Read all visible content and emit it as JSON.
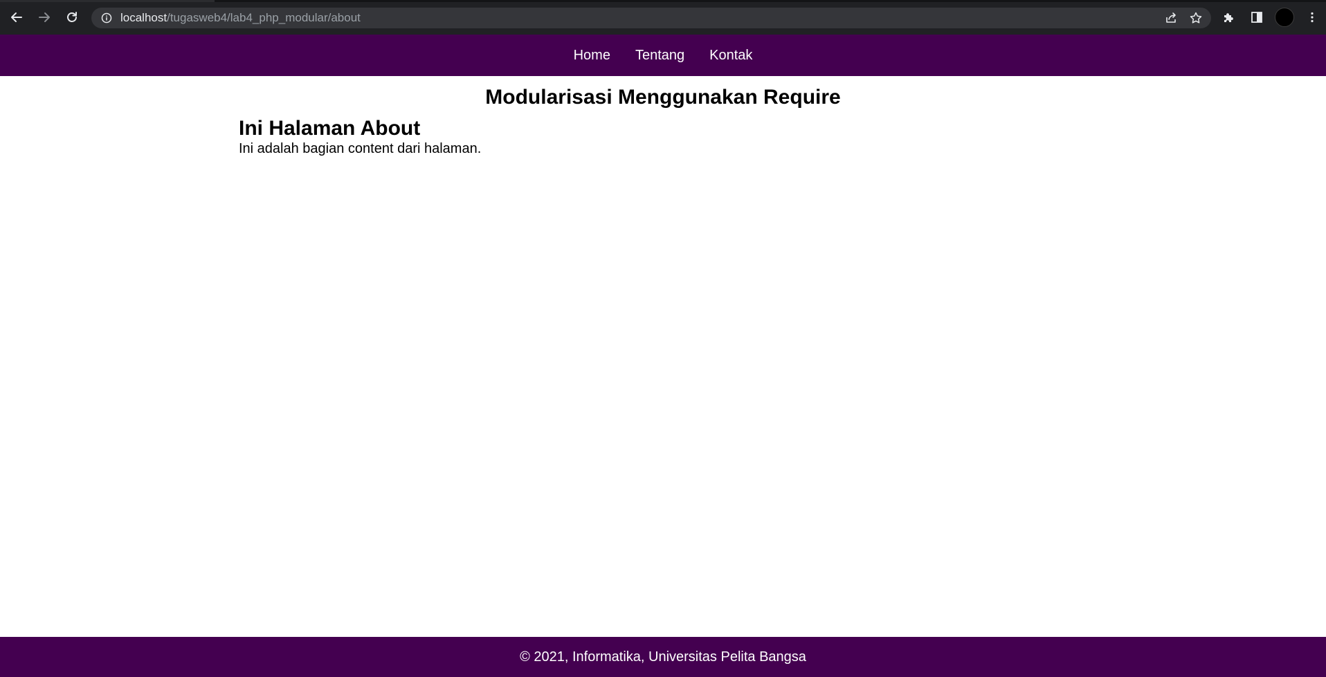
{
  "browser": {
    "url_host": "localhost",
    "url_path": "/tugasweb4/lab4_php_modular/about",
    "icons": {
      "back": "arrow-left-icon",
      "forward": "arrow-right-icon",
      "reload": "reload-icon",
      "info": "info-icon",
      "share": "share-icon",
      "bookmark": "star-icon",
      "extensions": "puzzle-icon",
      "side_panel": "side-panel-icon",
      "profile": "avatar",
      "menu": "kebab-menu-icon"
    }
  },
  "nav": {
    "items": [
      {
        "label": "Home"
      },
      {
        "label": "Tentang"
      },
      {
        "label": "Kontak"
      }
    ]
  },
  "page": {
    "site_title": "Modularisasi Menggunakan Require",
    "heading": "Ini Halaman About",
    "body": "Ini adalah bagian content dari halaman."
  },
  "footer": {
    "text": "© 2021, Informatika, Universitas Pelita Bangsa"
  },
  "colors": {
    "brand": "#440050",
    "browser_chrome": "#202124",
    "omnibox": "#35363a"
  }
}
